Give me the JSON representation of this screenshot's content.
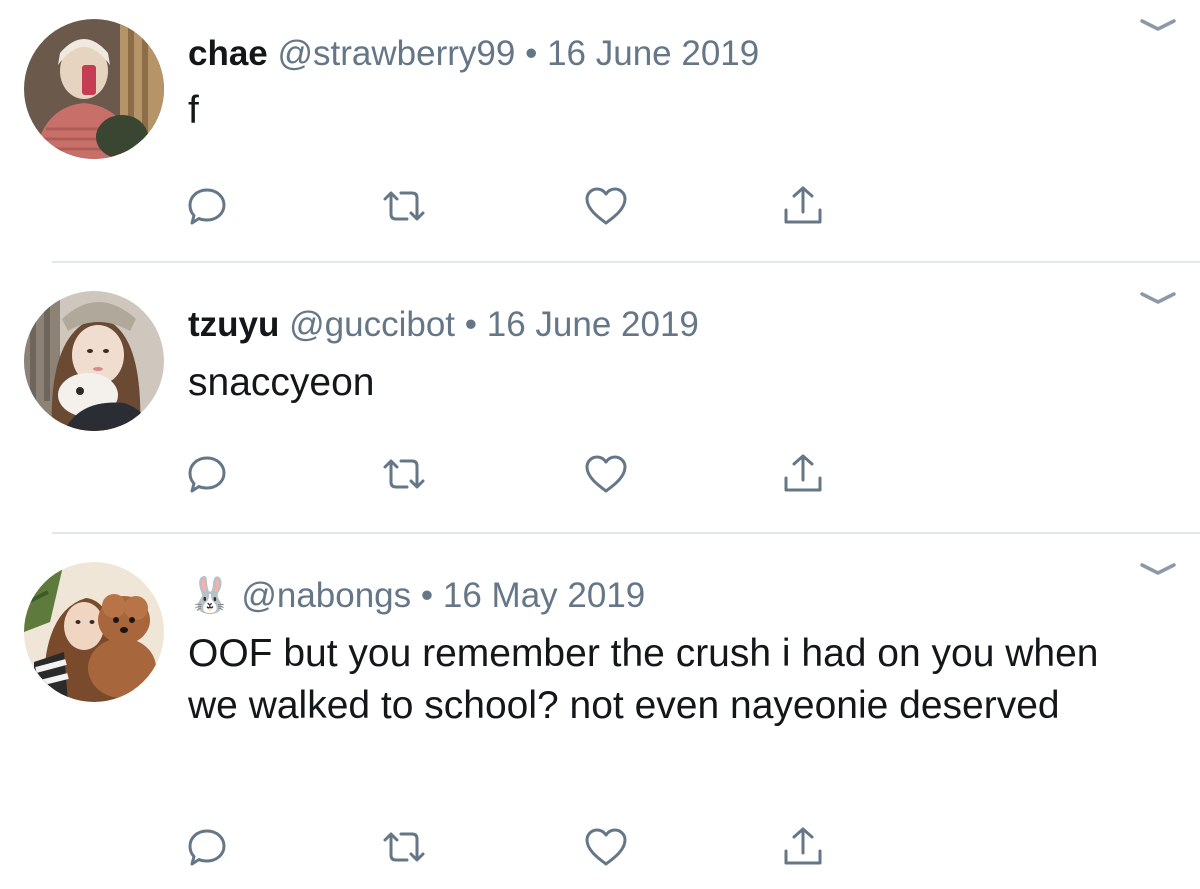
{
  "tweets": [
    {
      "display_name": "chae",
      "handle": "@strawberry99",
      "separator": "•",
      "date": "16 June 2019",
      "text": "f"
    },
    {
      "display_name": "tzuyu",
      "handle": "@guccibot",
      "separator": "•",
      "date": "16 June 2019",
      "text": "snaccyeon"
    },
    {
      "display_name": "🐰",
      "handle": "@nabongs",
      "separator": "•",
      "date": "16 May 2019",
      "text": "OOF but you remember the crush i had on you when we walked to school? not even nayeonie deserved"
    }
  ],
  "icons": {
    "reply": "reply-icon",
    "retweet": "retweet-icon",
    "like": "heart-icon",
    "share": "share-icon",
    "more": "chevron-down-icon"
  },
  "colors": {
    "primary_text": "#14171a",
    "secondary_text": "#657786",
    "icon": "#657786",
    "divider": "#e1e8ed"
  }
}
